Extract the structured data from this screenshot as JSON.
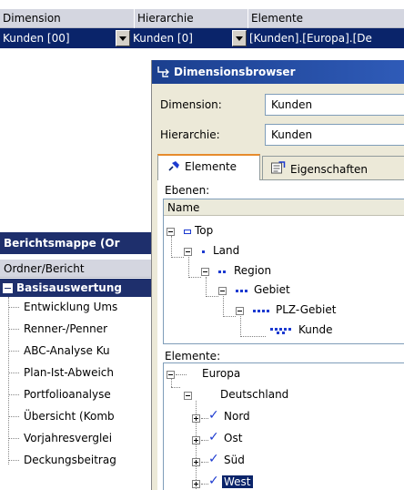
{
  "grid": {
    "headers": [
      "Dimension",
      "Hierarchie",
      "Elemente"
    ],
    "row": {
      "dimension": "Kunden [00]",
      "hierarchie": "Kunden [0]",
      "elemente": "[Kunden].[Europa].[De"
    }
  },
  "left": {
    "mappe_title": "Berichtsmappe (Or",
    "ordner_header": "Ordner/Bericht",
    "group": "Basisauswertung",
    "reports": [
      "Entwicklung Ums",
      "Renner-/Penner",
      "ABC-Analyse Ku",
      "Plan-Ist-Abweich",
      "Portfolioanalyse",
      "Übersicht (Komb",
      "Vorjahresverglei",
      "Deckungsbeitrag"
    ]
  },
  "dialog": {
    "title": "Dimensionsbrowser",
    "dimension_label": "Dimension:",
    "dimension_value": "Kunden",
    "hierarchie_label": "Hierarchie:",
    "hierarchie_value": "Kunden",
    "tabs": [
      "Elemente",
      "Eigenschaften"
    ],
    "ebenen_label": "Ebenen:",
    "name_header": "Name",
    "levels": [
      "Top",
      "Land",
      "Region",
      "Gebiet",
      "PLZ-Gebiet",
      "Kunde"
    ],
    "elemente_label": "Elemente:",
    "elements": {
      "europa": "Europa",
      "deutschland": "Deutschland",
      "children": [
        "Nord",
        "Ost",
        "Süd",
        "West"
      ],
      "selected": "West"
    }
  },
  "colors": {
    "selection": "#0a246a",
    "title_bar": "#1b3f8e",
    "tab_accent": "#e68b2c",
    "check": "#1c3ad0"
  }
}
